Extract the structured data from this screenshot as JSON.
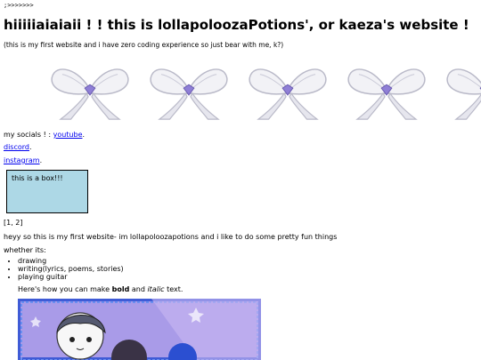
{
  "top_line": ";>>>>>>>",
  "title": "hiiiiiaiaiaii ! ! this is lollapoloozaPotions', or kaeza's website !",
  "subtitle": "(this is my first website and i have zero coding experience so just bear with me, k?)",
  "bows": [
    {
      "icon": "ribbon-bow-icon"
    },
    {
      "icon": "ribbon-bow-icon"
    },
    {
      "icon": "ribbon-bow-icon"
    },
    {
      "icon": "ribbon-bow-icon"
    },
    {
      "icon": "ribbon-bow-icon"
    }
  ],
  "socials": {
    "label": "my socials ! : ",
    "youtube": "youtube",
    "discord": "discord",
    "instagram": "instagram",
    "separator": "."
  },
  "box": {
    "text": "this is a box!!!",
    "color": "#add8e6"
  },
  "array_text": "[1, 2]",
  "intro": "heyy so this is my first website- im lollapoloozapotions and i like to do some pretty fun things",
  "whether": "whether its:",
  "list": [
    "drawing",
    "writing(lyrics, poems, stories)",
    "playing guitar"
  ],
  "bold_line": {
    "before": "Here's how you can make ",
    "bold": "bold",
    "middle": " and ",
    "italic": "italic",
    "after": " text."
  },
  "colors": {
    "link": "#0000ee",
    "art_background": "#a99be8",
    "art_frame": "#3f5bd6"
  }
}
